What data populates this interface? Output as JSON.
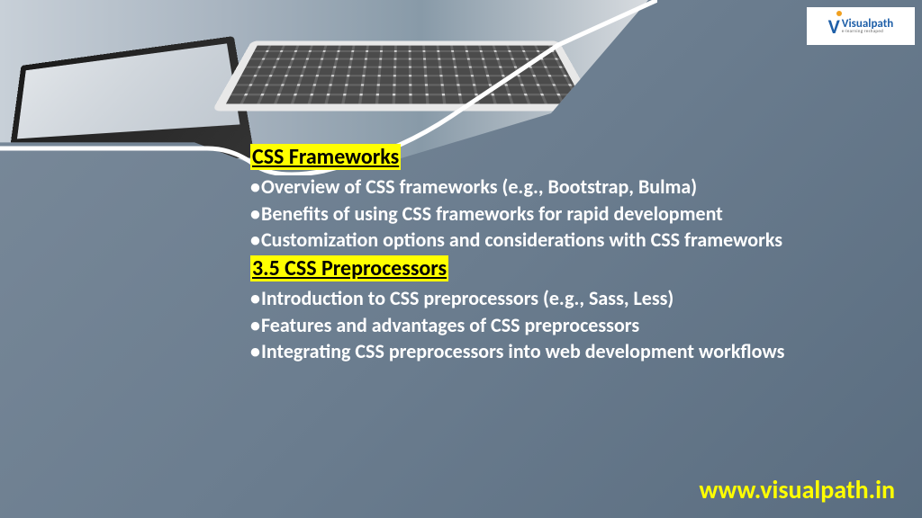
{
  "logo": {
    "brand": "Visualpath",
    "tagline": "e-learning reshaped"
  },
  "section1": {
    "heading": "CSS Frameworks",
    "bullets": [
      "Overview of CSS frameworks (e.g., Bootstrap, Bulma)",
      "Benefits of using CSS frameworks for rapid development",
      "Customization options and considerations with CSS frameworks"
    ]
  },
  "section2": {
    "heading": "3.5 CSS Preprocessors",
    "bullets": [
      "Introduction to CSS preprocessors (e.g., Sass, Less)",
      "Features and advantages of CSS preprocessors",
      "Integrating CSS preprocessors into web development workflows"
    ]
  },
  "footer": {
    "url": "www.visualpath.in"
  }
}
